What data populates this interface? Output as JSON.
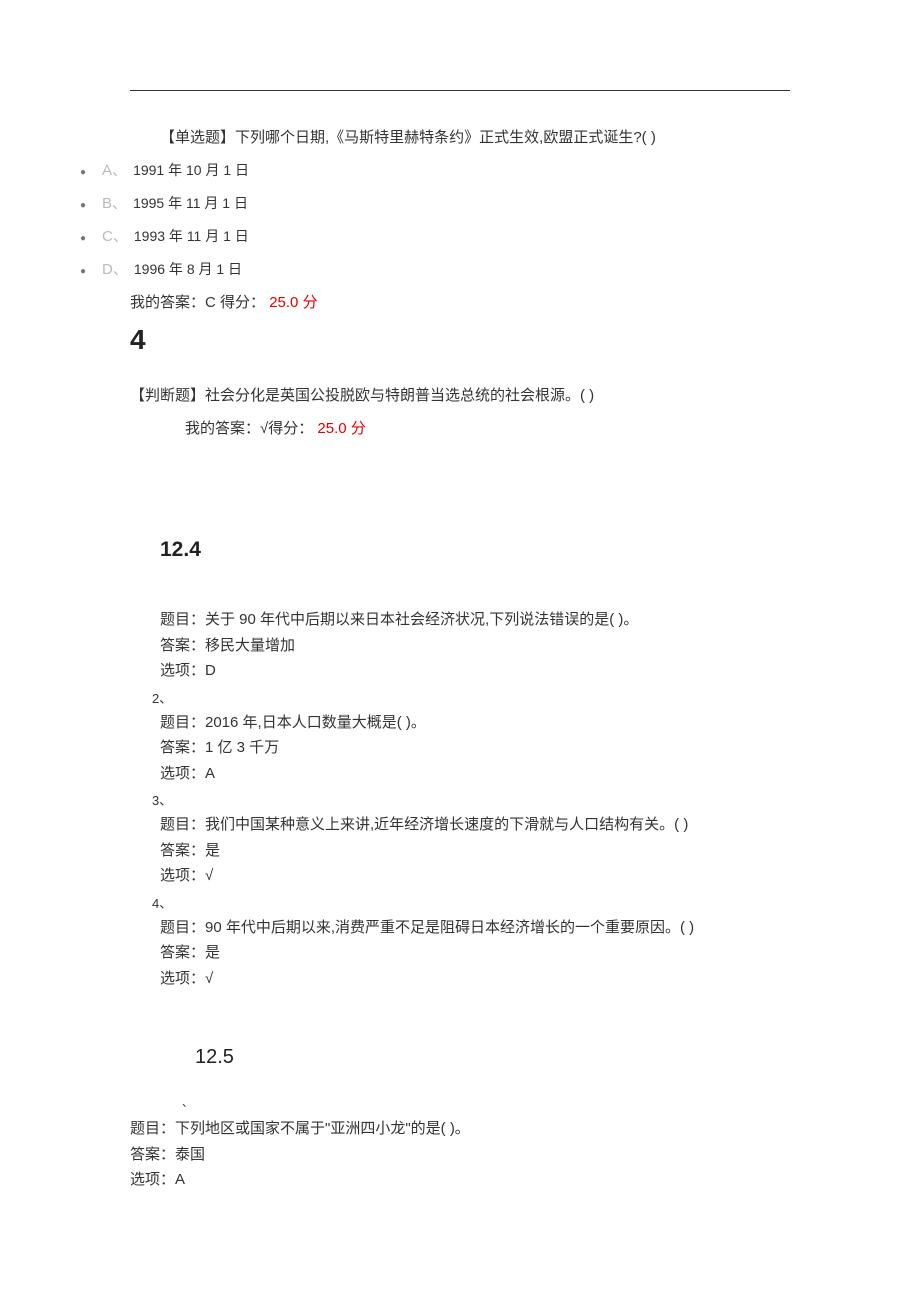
{
  "q3": {
    "stem": "【单选题】下列哪个日期,《马斯特里赫特条约》正式生效,欧盟正式诞生?( )",
    "options": [
      {
        "letter": "A、",
        "text": "1991 年 10 月 1 日"
      },
      {
        "letter": "B、",
        "text": "1995 年 11 月 1 日"
      },
      {
        "letter": "C、",
        "text": "1993 年 11 月 1 日"
      },
      {
        "letter": "D、",
        "text": "1996 年 8 月 1 日"
      }
    ],
    "my_answer_label": "我的答案：C 得分：",
    "score": "25.0",
    "score_unit": " 分"
  },
  "num4": "4",
  "q4": {
    "stem": "【判断题】社会分化是英国公投脱欧与特朗普当选总统的社会根源。( )",
    "my_answer_label": "我的答案：√得分：",
    "score": "25.0",
    "score_unit": " 分"
  },
  "section124": {
    "title": "12.4",
    "items": [
      {
        "q": "题目：关于 90 年代中后期以来日本社会经济状况,下列说法错误的是( )。",
        "a": "答案：移民大量增加",
        "opt": "选项：D"
      },
      {
        "idx": "2、",
        "q": "题目：2016 年,日本人口数量大概是( )。",
        "a": "答案：1 亿 3 千万",
        "opt": "选项：A"
      },
      {
        "idx": "3、",
        "q": "题目：我们中国某种意义上来讲,近年经济增长速度的下滑就与人口结构有关。( )",
        "a": "答案：是",
        "opt": "选项：√"
      },
      {
        "idx": "4、",
        "q": "题目：90 年代中后期以来,消费严重不足是阻碍日本经济增长的一个重要原因。( )",
        "a": "答案：是",
        "opt": "选项：√"
      }
    ]
  },
  "section125": {
    "title": "12.5",
    "tick": "、",
    "item": {
      "q": "题目：下列地区或国家不属于\"亚洲四小龙\"的是( )。",
      "a": "答案：泰国",
      "opt": "选项：A"
    }
  }
}
